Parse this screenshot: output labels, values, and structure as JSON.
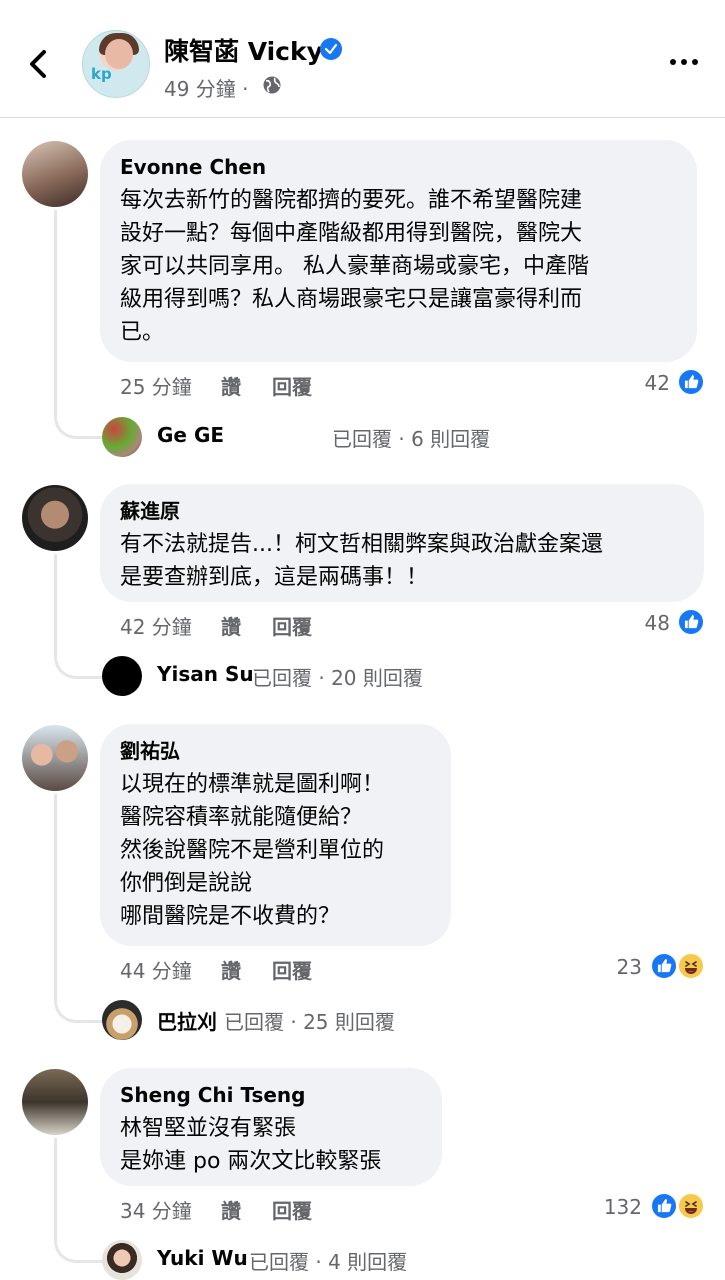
{
  "header": {
    "page_name": "陳智菡 Vicky",
    "time": "49 分鐘",
    "separator": "·",
    "icons": [
      "back-icon",
      "verified-icon",
      "globe-icon",
      "more-icon"
    ]
  },
  "actions": {
    "like": "讚",
    "reply": "回覆"
  },
  "comments": [
    {
      "author": "Evonne Chen",
      "text": "每次去新竹的醫院都擠的要死。誰不希望醫院建\n設好一點？每個中產階級都用得到醫院，醫院大\n家可以共同享用。  私人豪華商場或豪宅，中產階\n級用得到嗎？私人商場跟豪宅只是讓富豪得利而\n已。",
      "time": "25 分鐘",
      "reactions": "42",
      "reaction_types": [
        "like"
      ],
      "reply_author": "Ge  GE",
      "reply_summary": "已回覆 · 6 則回覆"
    },
    {
      "author": "蘇進原",
      "text": "有不法就提告...！柯文哲相關弊案與政治獻金案還\n是要查辦到底，這是兩碼事！！",
      "time": "42 分鐘",
      "reactions": "48",
      "reaction_types": [
        "like"
      ],
      "reply_author": "Yisan Su",
      "reply_summary": "已回覆 · 20 則回覆"
    },
    {
      "author": "劉祐弘",
      "text": "以現在的標準就是圖利啊！\n醫院容積率就能隨便給？\n然後說醫院不是營利單位的\n你們倒是說說\n哪間醫院是不收費的？",
      "time": "44 分鐘",
      "reactions": "23",
      "reaction_types": [
        "like",
        "haha"
      ],
      "reply_author": "巴拉刈",
      "reply_summary": "已回覆 · 25 則回覆"
    },
    {
      "author": "Sheng Chi Tseng",
      "text": "林智堅並沒有緊張\n是妳連 po 兩次文比較緊張",
      "time": "34 分鐘",
      "reactions": "132",
      "reaction_types": [
        "like",
        "haha"
      ],
      "reply_author": "Yuki Wu",
      "reply_summary": "已回覆 · 4 則回覆"
    }
  ],
  "colors": {
    "bubble": "#f0f2f5",
    "secondary_text": "#65676b",
    "like_blue": "#1877f2",
    "haha_yellow": "#f7c94b"
  }
}
